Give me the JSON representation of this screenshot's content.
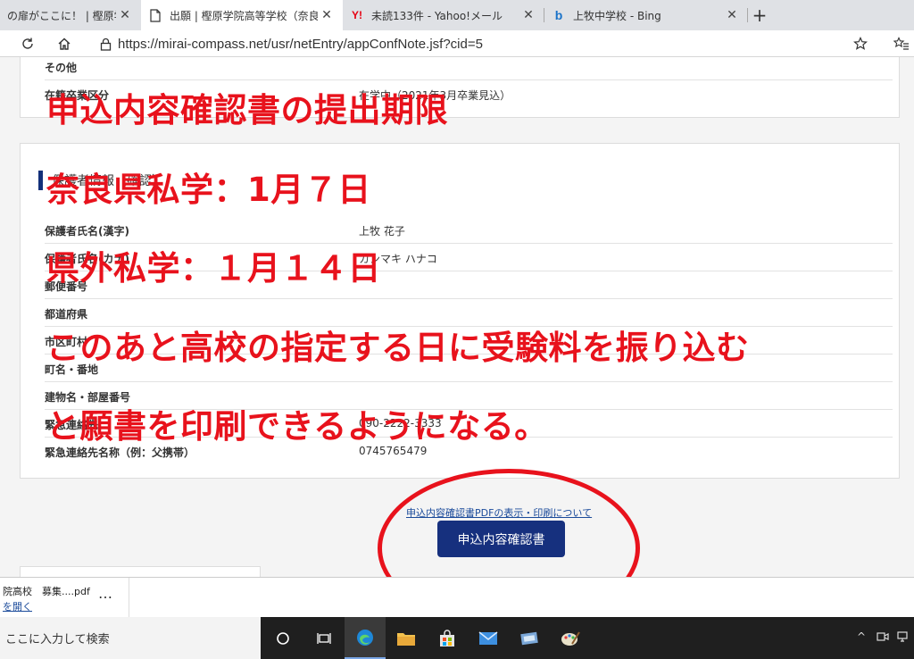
{
  "browser": {
    "tabs": [
      {
        "title": "の扉がここに！ | 樫原学院高",
        "active": false
      },
      {
        "title": "出願 | 樫原学院高等学校（奈良",
        "active": true
      },
      {
        "title": "未読133件 - Yahoo!メール",
        "active": false
      },
      {
        "title": "上牧中学校 - Bing",
        "active": false
      }
    ],
    "new_tab": "+",
    "url": "https://mirai-compass.net/usr/netEntry/appConfNote.jsf?cid=5"
  },
  "form": {
    "top_rows": [
      {
        "label": "その他",
        "value": ""
      },
      {
        "label": "在籍卒業区分",
        "value": "在学中（2021年3月卒業見込）"
      }
    ],
    "guardian_section_title": "保護者情報（確認）",
    "guardian_rows": [
      {
        "label": "保護者氏名(漢字)",
        "value": "上牧 花子"
      },
      {
        "label": "保護者氏名(カナ)",
        "value": "カンマキ ハナコ"
      },
      {
        "label": "郵便番号",
        "value": ""
      },
      {
        "label": "都道府県",
        "value": ""
      },
      {
        "label": "市区町村",
        "value": ""
      },
      {
        "label": "町名・番地",
        "value": ""
      },
      {
        "label": "建物名・部屋番号",
        "value": ""
      },
      {
        "label": "緊急連絡先",
        "value": "090-2222-3333"
      },
      {
        "label": "緊急連絡先名称（例：父携帯）",
        "value": "0745765479"
      }
    ],
    "pdf_link": "申込内容確認書PDFの表示・印刷について",
    "confirm_button": "申込内容確認書"
  },
  "annotation": {
    "lines": [
      "申込内容確認書の提出期限",
      "奈良県私学：1月７日",
      "県外私学：１月１４日",
      "このあと高校の指定する日に受験料を振り込む",
      "と願書を印刷できるようになる。"
    ],
    "color": "#e8121c"
  },
  "downloads": {
    "file_name": "院高校　募集....pdf",
    "open_link": "を開く",
    "more": "…"
  },
  "taskbar": {
    "search_placeholder": "ここに入力して検索"
  }
}
